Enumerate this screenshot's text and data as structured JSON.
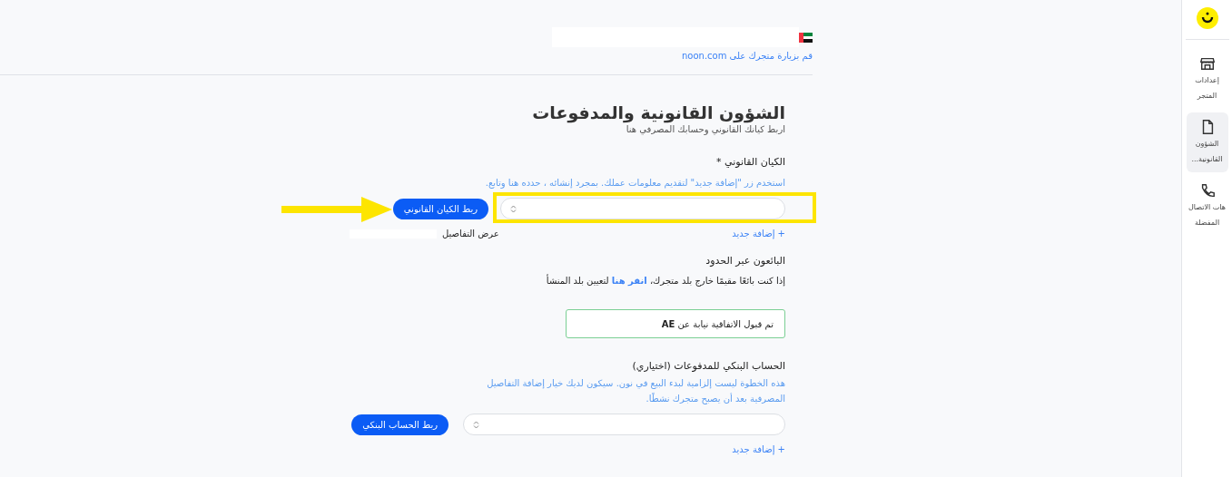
{
  "header": {
    "store_link": "قم بزيارة متجرك على noon.com"
  },
  "page": {
    "title": "الشؤون القانونية والمدفوعات",
    "subtitle": "اربط كيانك القانوني وحسابك المصرفي هنا"
  },
  "legal_entity": {
    "label": "الكيان القانوني *",
    "hint": "استخدم زر \"إضافة جديد\" لتقديم معلومات عملك. بمجرد إنشائه ، حدده هنا وتابع.",
    "button": "ربط الكيان القانوني",
    "add_new": "+ إضافة جديد",
    "details": "عرض التفاصيل",
    "highlighted": true
  },
  "cross_border": {
    "title": "البائعون عبر الحدود",
    "text_before": "إذا كنت بائعًا مقيمًا خارج بلد متجرك،",
    "link": "انقر هنا",
    "text_after": "لتعيين بلد المنشأ"
  },
  "agreement": {
    "text": "تم قبول الاتفاقية نيابة عن **AE**"
  },
  "bank": {
    "label": "الحساب البنكي للمدفوعات (اختياري)",
    "hint": "هذه الخطوة ليست إلزامية لبدء البيع في نون. سيكون لديك خيار إضافة التفاصيل المصرفية بعد أن يصبح متجرك نشطًا.",
    "button": "ربط الحساب البنكي",
    "add_new": "+ إضافة جديد"
  },
  "sidebar": {
    "items": [
      {
        "kind": "store",
        "label": "إعدادات المتجر",
        "selected": false
      },
      {
        "kind": "document",
        "label": "الشؤون القانونية...",
        "selected": true
      },
      {
        "kind": "phone",
        "label": "هات الاتصال المفضلة",
        "selected": false
      }
    ]
  }
}
